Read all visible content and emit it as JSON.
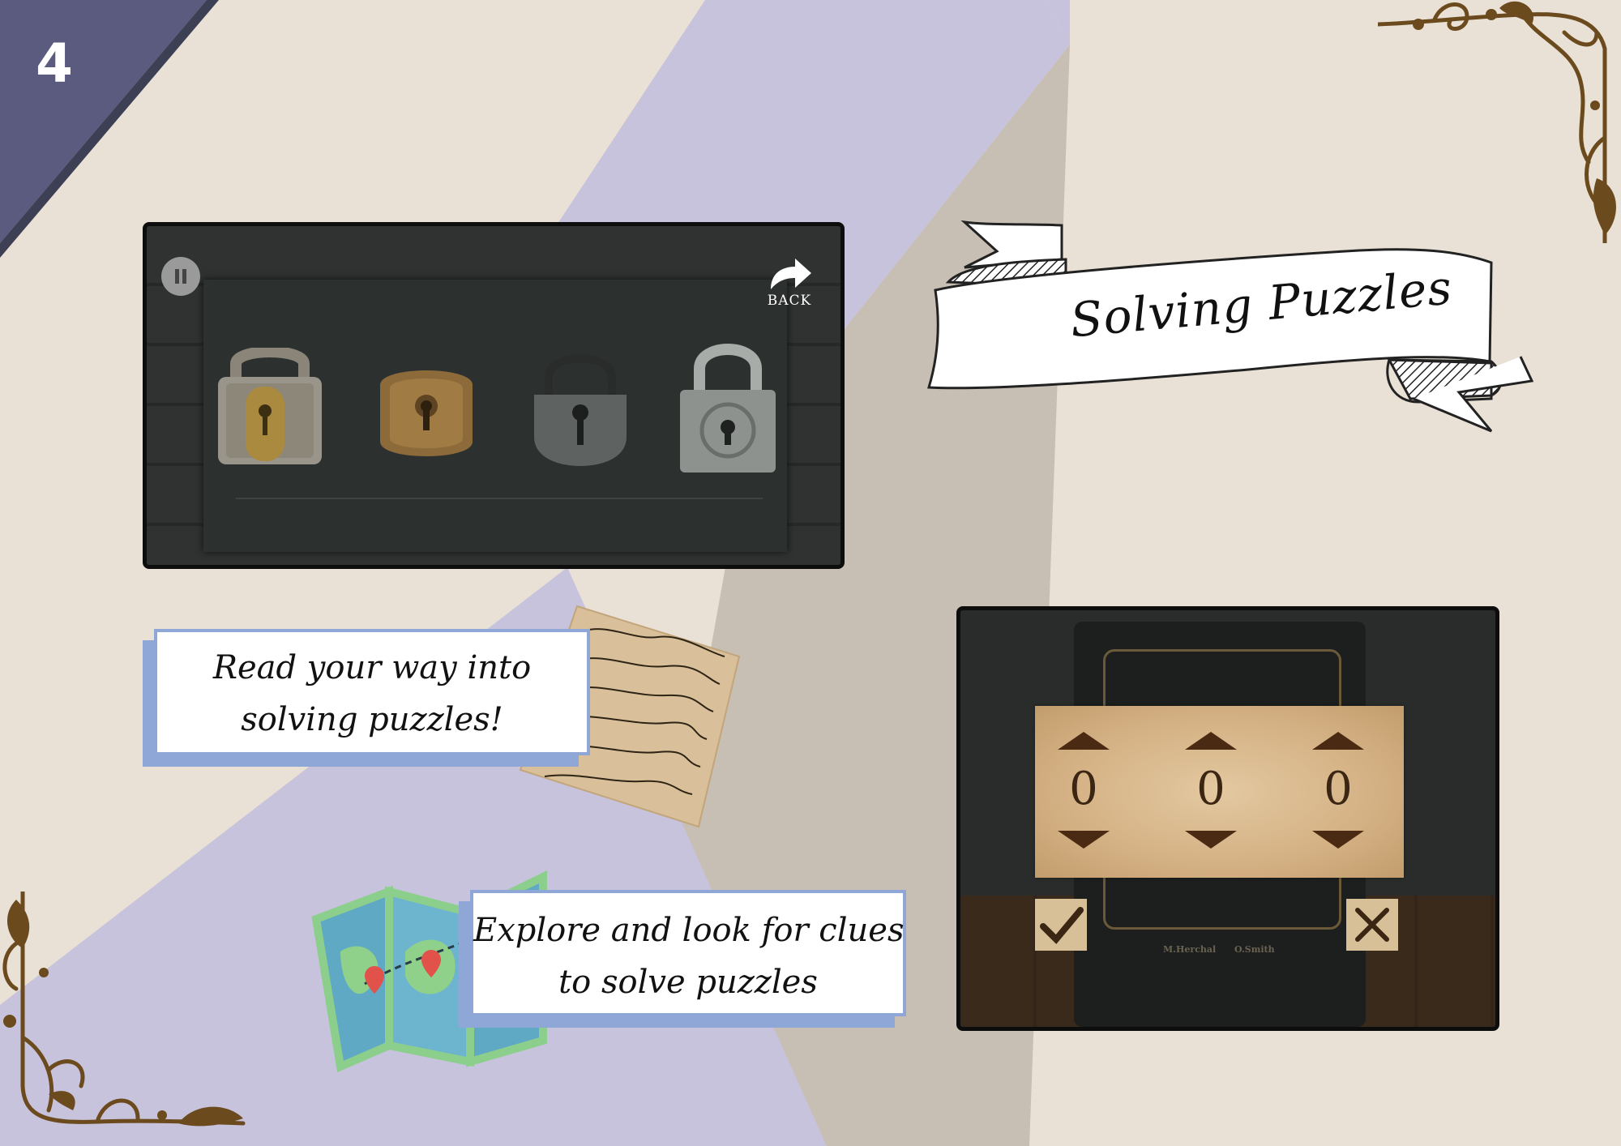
{
  "page": {
    "number": "4"
  },
  "colors": {
    "background": "#e9e1d6",
    "lavender": "#c8c3dc",
    "taupe": "#c7beb4",
    "corner_tab": "#5a5b7e",
    "caption_border": "#8fa7d6",
    "ornament": "#6b4a1e"
  },
  "title": {
    "text": "Solving Puzzles"
  },
  "lock_screen": {
    "pause_icon": "pause-icon",
    "back_label": "BACK",
    "locks": [
      {
        "name": "rusty-padlock"
      },
      {
        "name": "bronze-padlock"
      },
      {
        "name": "iron-padlock"
      },
      {
        "name": "silver-padlock"
      }
    ]
  },
  "captions": {
    "read": {
      "line1": "Read your way into",
      "line2": "solving puzzles!"
    },
    "explore": {
      "line1": "Explore and look for clues",
      "line2": "to solve puzzles"
    }
  },
  "code_lock": {
    "digits": [
      "0",
      "0",
      "0"
    ],
    "confirm_icon": "checkmark-icon",
    "cancel_icon": "close-icon",
    "safe_names": [
      "M.Herchal",
      "O.Smith"
    ]
  }
}
